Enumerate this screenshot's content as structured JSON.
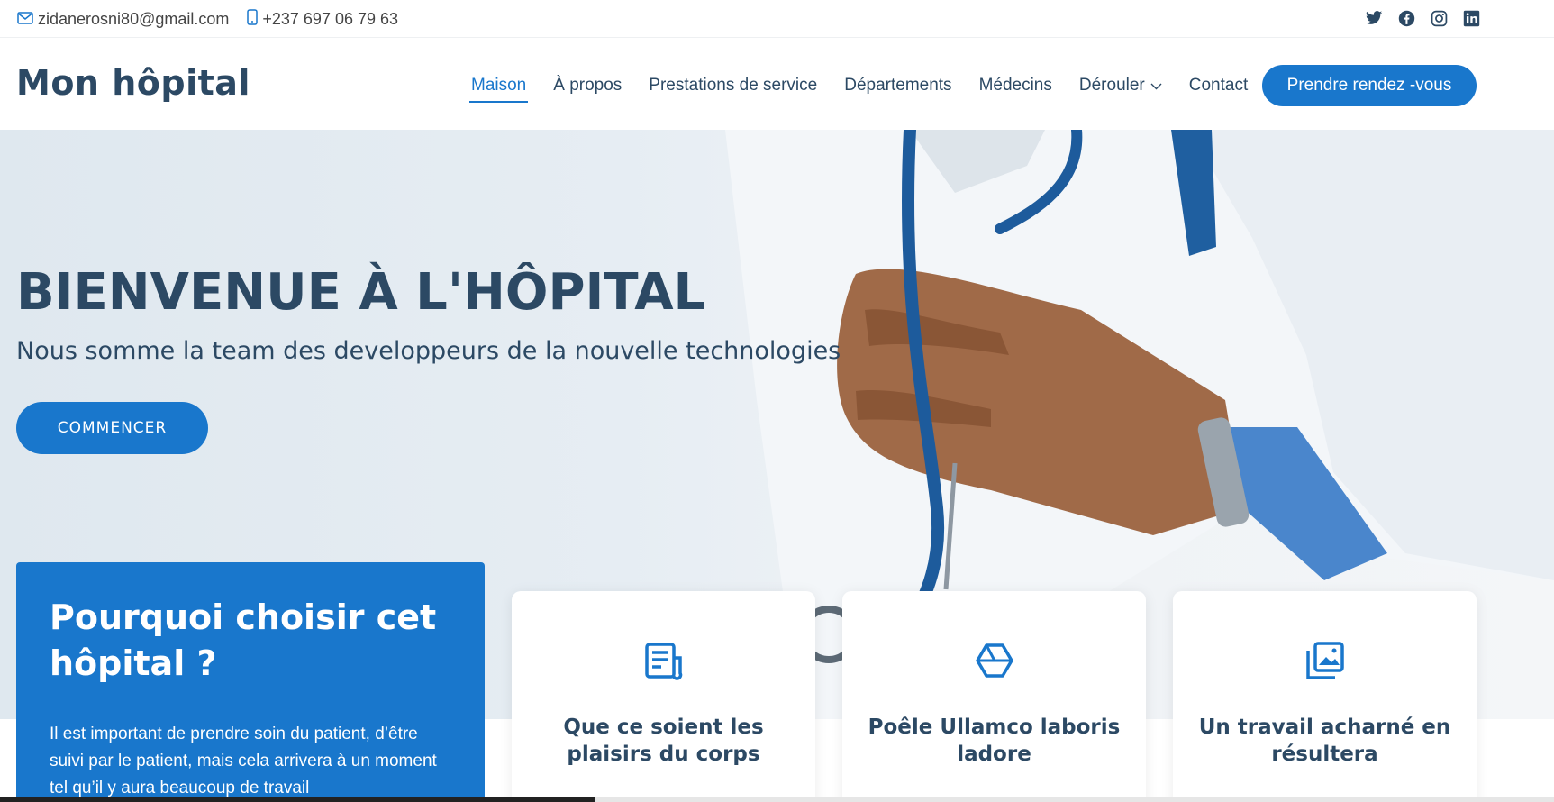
{
  "topbar": {
    "email": "zidanerosni80@gmail.com",
    "phone": "+237 697 06 79 63",
    "social": [
      "twitter-icon",
      "facebook-icon",
      "instagram-icon",
      "linkedin-icon"
    ]
  },
  "header": {
    "logo": "Mon hôpital",
    "nav": [
      "Maison",
      "À propos",
      "Prestations de service",
      "Départements",
      "Médecins",
      "Dérouler",
      "Contact"
    ],
    "active_nav": "Maison",
    "appointment_label": "Prendre rendez -vous"
  },
  "hero": {
    "title": "BIENVENUE À L'HÔPITAL",
    "subtitle": "Nous somme la team des developpeurs de la nouvelle technologies",
    "cta_label": "COMMENCER"
  },
  "why": {
    "title": "Pourquoi choisir cet hôpital ?",
    "text": "Il est important de prendre soin du patient, d’être suivi par le patient, mais cela arrivera à un moment tel qu’il y aura beaucoup de travail"
  },
  "cards": [
    {
      "icon": "receipt-icon",
      "title": "Que ce soient les plaisirs du corps"
    },
    {
      "icon": "cube-icon",
      "title": "Poêle Ullamco laboris ladore"
    },
    {
      "icon": "images-icon",
      "title": "Un travail acharné en résultera"
    }
  ],
  "colors": {
    "accent": "#1977cc",
    "heading": "#2c4964"
  }
}
